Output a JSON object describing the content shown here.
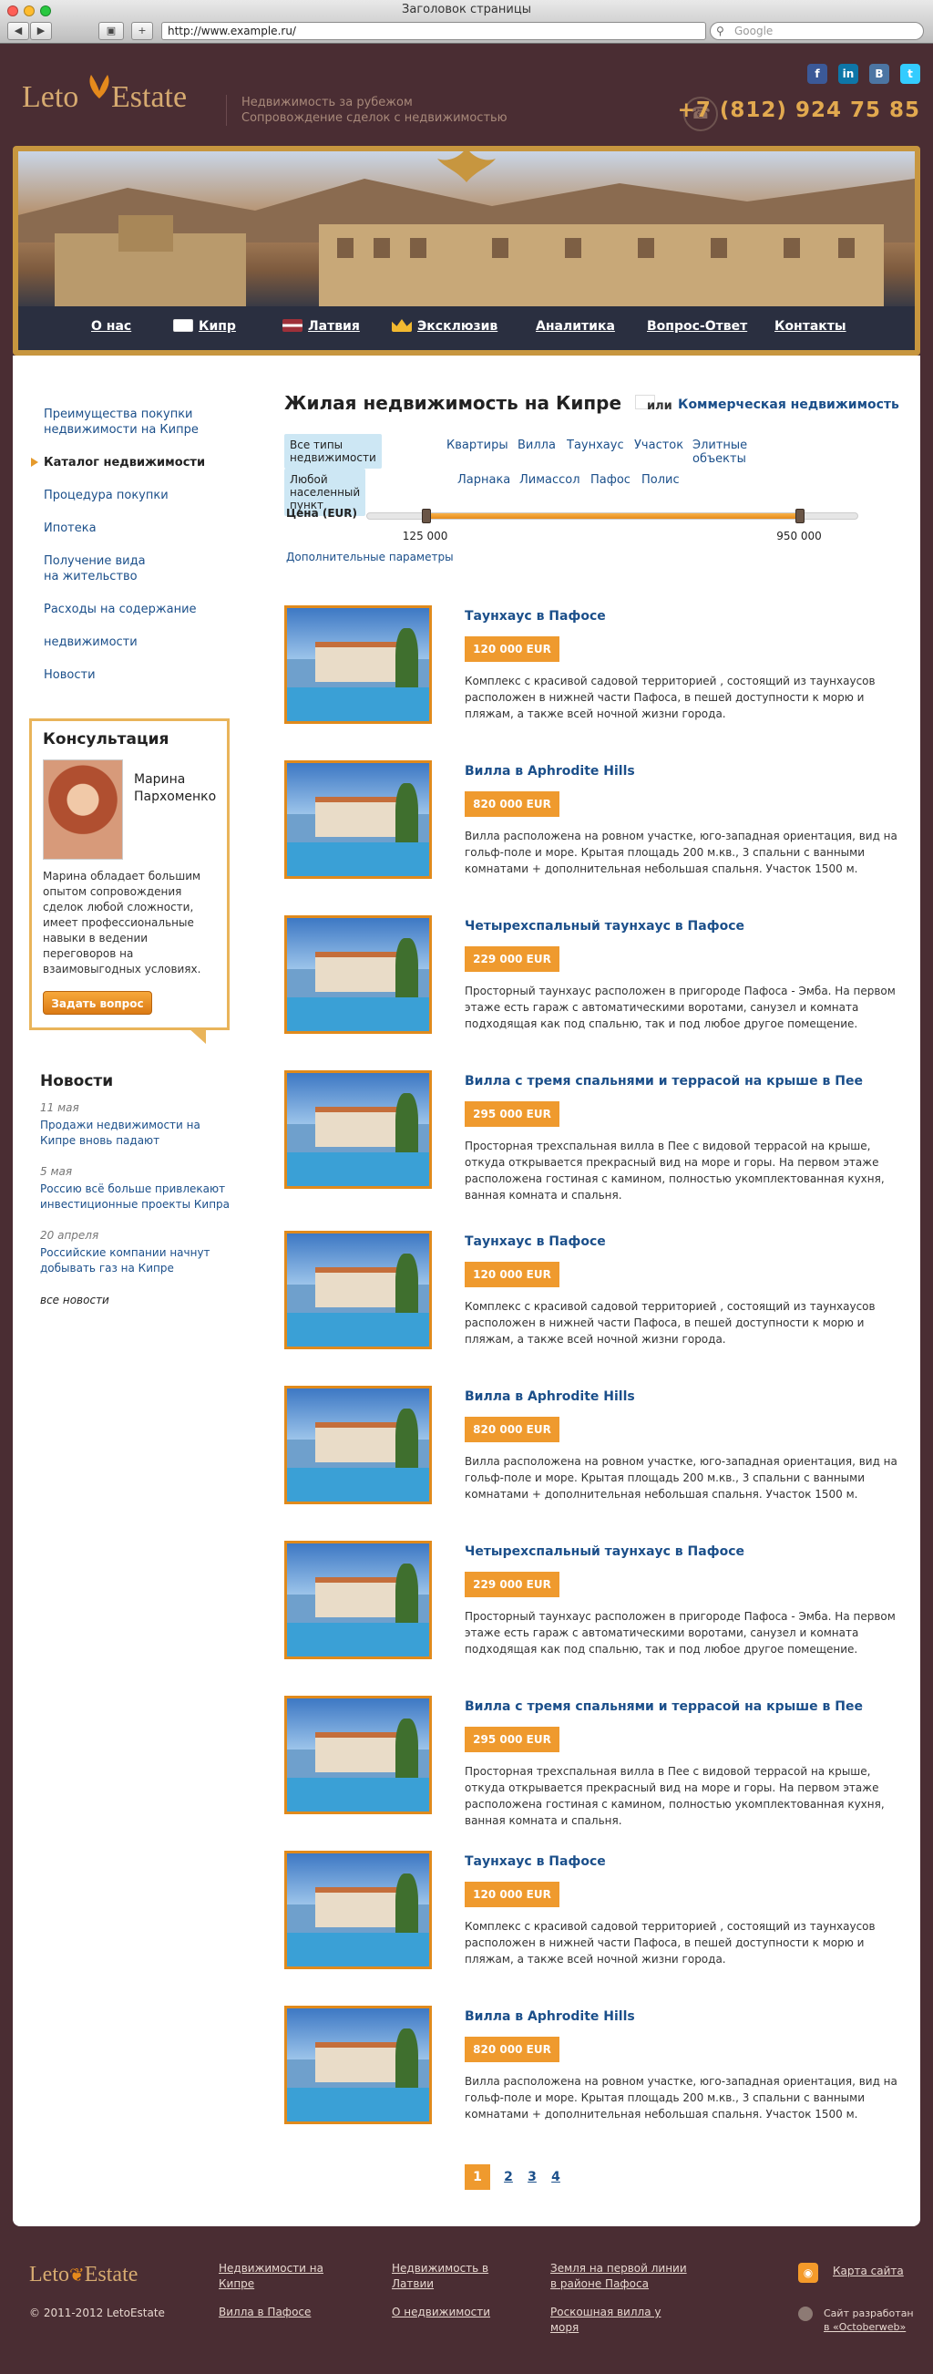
{
  "browser": {
    "window_title": "Заголовок страницы",
    "url": "http://www.example.ru/",
    "search_placeholder": "Google"
  },
  "header": {
    "logo_part1": "Leto",
    "logo_part2": "Estate",
    "tagline_line1": "Недвижимость за рубежом",
    "tagline_line2": "Сопровождение сделок с недвижимостью",
    "phone": "+7 (812) 924 75 85",
    "socials": [
      "facebook-icon",
      "linkedin-icon",
      "vkontakte-icon",
      "twitter-icon"
    ]
  },
  "nav": {
    "items": [
      "О нас",
      "Кипр",
      "Латвия",
      "Эксклюзив",
      "Аналитика",
      "Вопрос-Ответ",
      "Контакты"
    ]
  },
  "sidebar": {
    "links": [
      "Преимущества покупки недвижимости на Кипре",
      "Каталог недвижимости",
      "Процедура покупки",
      "Ипотека",
      "Получение вида на жительство",
      "Расходы на содержание",
      "недвижимости",
      "Новости"
    ]
  },
  "consult": {
    "title": "Консультация",
    "name_line1": "Марина",
    "name_line2": "Пархоменко",
    "description": "Марина обладает большим опытом сопровождения сделок любой сложности, имеет профессиональные навыки в ведении переговоров на взаимовыгодных условиях.",
    "button": "Задать вопрос"
  },
  "news": {
    "title": "Новости",
    "items": [
      {
        "date": "11 мая",
        "text": "Продажи недвижимости на Кипре вновь падают"
      },
      {
        "date": "5 мая",
        "text": "Россию всё больше привлекают инвестиционные проекты Кипра"
      },
      {
        "date": "20 апреля",
        "text": "Российские компании начнут добывать газ на Кипре"
      }
    ],
    "all_link": "все новости"
  },
  "main": {
    "title": "Жилая недвижимость на Кипре",
    "or_text": "или",
    "alt_link": "Коммерческая недвижимость",
    "type_filter": {
      "selected": "Все типы недвижимости",
      "options": [
        "Квартиры",
        "Вилла",
        "Таунхаус",
        "Участок",
        "Элитные объекты"
      ]
    },
    "place_filter": {
      "selected": "Любой населенный пункт",
      "options": [
        "Ларнака",
        "Лимассол",
        "Пафос",
        "Полис"
      ]
    },
    "price": {
      "label": "Цена (EUR)",
      "min": "125 000",
      "max": "950 000",
      "min_fraction": 0.12,
      "max_fraction": 0.88
    },
    "more_params": "Дополнительные параметры"
  },
  "listings": [
    {
      "title": "Таунхаус в Пафосе",
      "price": "120 000 EUR",
      "desc": "Комплекс с красивой садовой территорией , состоящий из таунхаусов расположен в нижней части Пафоса, в пешей доступности к морю и пляжам, а также всей ночной жизни города."
    },
    {
      "title": "Вилла в Aphrodite Hills",
      "price": "820 000 EUR",
      "desc": "Вилла расположена на ровном участке, юго-западная ориентация, вид на гольф-поле и море. Крытая площадь 200 м.кв., 3 спальни с ванными комнатами + дополнительная небольшая спальня. Участок 1500 м."
    },
    {
      "title": "Четырехспальный таунхаус в Пафосе",
      "price": "229 000 EUR",
      "desc": "Просторный  таунхаус расположен в пригороде Пафоса - Эмба. На первом этаже есть гараж с автоматическими воротами, санузел и комната подходящая как под спальню, так и под любое другое помещение."
    },
    {
      "title": "Вилла с тремя спальнями и террасой на крыше в Пее",
      "price": "295 000 EUR",
      "desc": "Просторная трехспальная вилла в Пее с видовой террасой на крыше, откуда открывается прекрасный вид на море и горы. На первом этаже расположена гостиная с камином, полностью укомплектованная кухня, ванная комната и спальня."
    },
    {
      "title": "Таунхаус в Пафосе",
      "price": "120 000 EUR",
      "desc": "Комплекс с красивой садовой территорией , состоящий из таунхаусов расположен в нижней части Пафоса, в пешей доступности к морю и пляжам, а также всей ночной жизни города."
    },
    {
      "title": "Вилла в Aphrodite Hills",
      "price": "820 000 EUR",
      "desc": "Вилла расположена на ровном участке, юго-западная ориентация, вид на гольф-поле и море. Крытая площадь 200 м.кв., 3 спальни с ванными комнатами + дополнительная небольшая спальня. Участок 1500 м."
    },
    {
      "title": "Четырехспальный таунхаус в Пафосе",
      "price": "229 000 EUR",
      "desc": "Просторный  таунхаус расположен в пригороде Пафоса - Эмба. На первом этаже есть гараж с автоматическими воротами, санузел и комната подходящая как под спальню, так и под любое другое помещение."
    },
    {
      "title": "Вилла с тремя спальнями и террасой на крыше в Пее",
      "price": "295 000 EUR",
      "desc": "Просторная трехспальная вилла в Пее с видовой террасой на крыше, откуда открывается прекрасный вид на море и горы. На первом этаже расположена гостиная с камином, полностью укомплектованная кухня, ванная комната и спальня."
    },
    {
      "title": "Таунхаус в Пафосе",
      "price": "120 000 EUR",
      "desc": "Комплекс с красивой садовой территорией , состоящий из таунхаусов расположен в нижней части Пафоса, в пешей доступности к морю и пляжам, а также всей ночной жизни города."
    },
    {
      "title": "Вилла в Aphrodite Hills",
      "price": "820 000 EUR",
      "desc": "Вилла расположена на ровном участке, юго-западная ориентация, вид на гольф-поле и море. Крытая площадь 200 м.кв., 3 спальни с ванными комнатами + дополнительная небольшая спальня. Участок 1500 м."
    }
  ],
  "pagination": {
    "pages": [
      "1",
      "2",
      "3",
      "4"
    ],
    "current": "1"
  },
  "footer": {
    "logo_part1": "Leto",
    "logo_part2": "Estate",
    "copyright": "© 2011-2012 LetoEstate",
    "col1": [
      "Недвижимости на Кипре",
      "Вилла в Пафосе"
    ],
    "col2": [
      "Недвижимость в Латвии",
      "О недвижимости"
    ],
    "col3": [
      "Земля на первой линии в районе Пафоса",
      "Роскошная  вилла у моря"
    ],
    "sitemap": "Карта сайта",
    "dev_line1": "Сайт разработан",
    "dev_line2": "в «Octoberweb»"
  },
  "colors": {
    "background": "#4a2d33",
    "accent": "#ef9a2e",
    "link": "#1b4f8a",
    "gold": "#c7963f"
  }
}
